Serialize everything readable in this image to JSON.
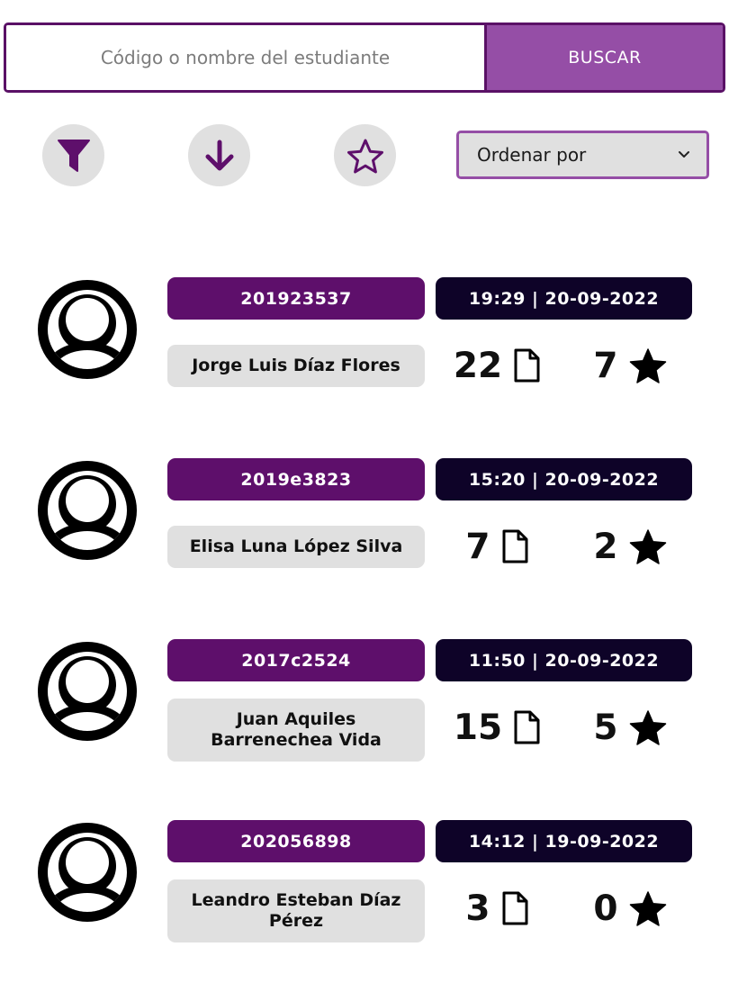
{
  "search": {
    "placeholder": "Código o nombre del estudiante",
    "button_label": "BUSCAR"
  },
  "toolbar": {
    "filter_icon": "funnel-icon",
    "download_icon": "arrow-down-icon",
    "favorites_icon": "star-outline-icon",
    "sort_label": "Ordenar por"
  },
  "colors": {
    "accent": "#954ea6",
    "code_bg": "#5e0f6b",
    "date_bg": "#0e0328",
    "pill_gray": "#e0e0e0"
  },
  "students": [
    {
      "code": "201923537",
      "datetime": "19:29 | 20-09-2022",
      "name": "Jorge Luis Díaz Flores",
      "files": "22",
      "stars": "7"
    },
    {
      "code": "2019e3823",
      "datetime": "15:20 | 20-09-2022",
      "name": "Elisa Luna López Silva",
      "files": "7",
      "stars": "2"
    },
    {
      "code": "2017c2524",
      "datetime": "11:50 | 20-09-2022",
      "name": "Juan Aquiles Barrenechea Vida",
      "files": "15",
      "stars": "5"
    },
    {
      "code": "202056898",
      "datetime": "14:12 | 19-09-2022",
      "name": "Leandro Esteban Díaz Pérez",
      "files": "3",
      "stars": "0"
    }
  ]
}
